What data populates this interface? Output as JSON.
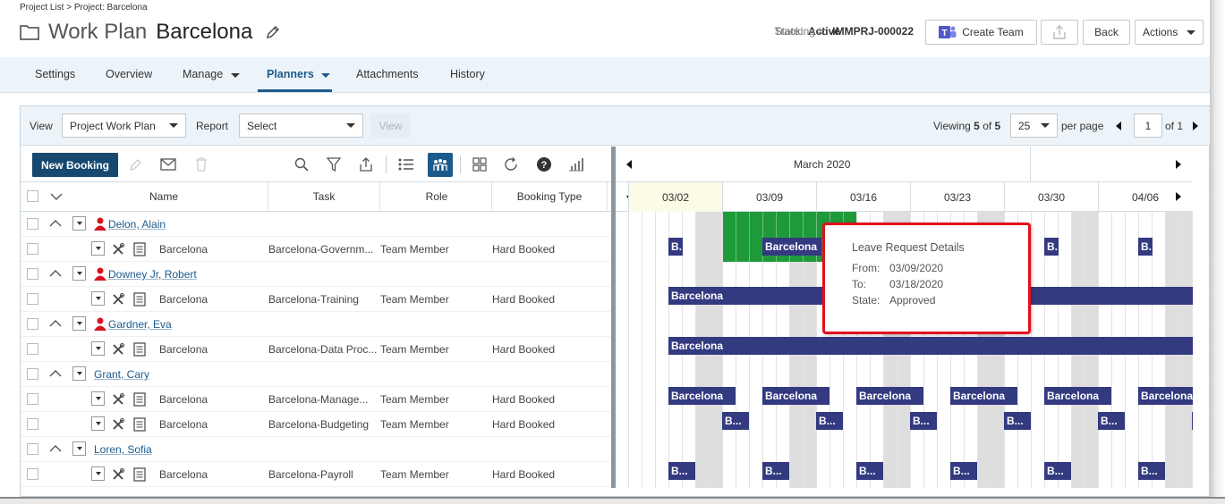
{
  "breadcrumb": "Project List > Project: Barcelona",
  "header": {
    "page_label": "Work Plan",
    "project_name": "Barcelona",
    "state_label": "State:",
    "state_value": "Active",
    "tracking_label": "Tracking #:",
    "tracking_value": "IMMPRJ-000022",
    "create_team_label": "Create Team",
    "back_label": "Back",
    "actions_label": "Actions"
  },
  "nav": {
    "tabs": [
      {
        "label": "Settings"
      },
      {
        "label": "Overview"
      },
      {
        "label": "Manage"
      },
      {
        "label": "Planners"
      },
      {
        "label": "Attachments"
      },
      {
        "label": "History"
      }
    ]
  },
  "toolbar": {
    "view_label": "View",
    "view_value": "Project Work Plan",
    "report_label": "Report",
    "report_value": "Select",
    "view_button": "View",
    "viewing_prefix": "Viewing",
    "viewing_shown": "5",
    "viewing_of": "of",
    "viewing_total": "5",
    "per_page_value": "25",
    "per_page_label": "per page",
    "page_value": "1",
    "page_of": "of 1"
  },
  "grid": {
    "new_booking_label": "New Booking",
    "columns": {
      "name": "Name",
      "task": "Task",
      "role": "Role",
      "booking_type": "Booking Type"
    },
    "rows": [
      {
        "type": "resource",
        "name": "Delon, Alain",
        "user_icon": true
      },
      {
        "type": "booking",
        "name": "Barcelona",
        "task": "Barcelona-Governm...",
        "role": "Team Member",
        "booking_type": "Hard Booked"
      },
      {
        "type": "resource",
        "name": "Downey Jr, Robert",
        "user_icon": true
      },
      {
        "type": "booking",
        "name": "Barcelona",
        "task": "Barcelona-Training",
        "role": "Team Member",
        "booking_type": "Hard Booked"
      },
      {
        "type": "resource",
        "name": "Gardner, Eva",
        "user_icon": true
      },
      {
        "type": "booking",
        "name": "Barcelona",
        "task": "Barcelona-Data Proc...",
        "role": "Team Member",
        "booking_type": "Hard Booked"
      },
      {
        "type": "resource",
        "name": "Grant, Cary",
        "user_icon": false
      },
      {
        "type": "booking",
        "name": "Barcelona",
        "task": "Barcelona-Manage...",
        "role": "Team Member",
        "booking_type": "Hard Booked"
      },
      {
        "type": "booking",
        "name": "Barcelona",
        "task": "Barcelona-Budgeting",
        "role": "Team Member",
        "booking_type": "Hard Booked"
      },
      {
        "type": "resource",
        "name": "Loren, Sofia",
        "user_icon": false
      },
      {
        "type": "booking",
        "name": "Barcelona",
        "task": "Barcelona-Payroll",
        "role": "Team Member",
        "booking_type": "Hard Booked"
      }
    ]
  },
  "gantt": {
    "month": "March 2020",
    "weeks": [
      "03/02",
      "03/09",
      "03/16",
      "03/23",
      "03/30",
      "04/06"
    ],
    "bar_labels": {
      "short_b": "B.",
      "full": "Barcelona",
      "ellipsis": "B..."
    }
  },
  "popup": {
    "title": "Leave Request Details",
    "from_label": "From:",
    "from_value": "03/09/2020",
    "to_label": "To:",
    "to_value": "03/18/2020",
    "state_label": "State:",
    "state_value": "Approved"
  },
  "colors": {
    "primary": "#17486f",
    "link": "#1c5a8b",
    "bar": "#333a80",
    "leave": "#1f9a3b",
    "highlight": "#e2101c",
    "user_icon": "#d9121f"
  }
}
